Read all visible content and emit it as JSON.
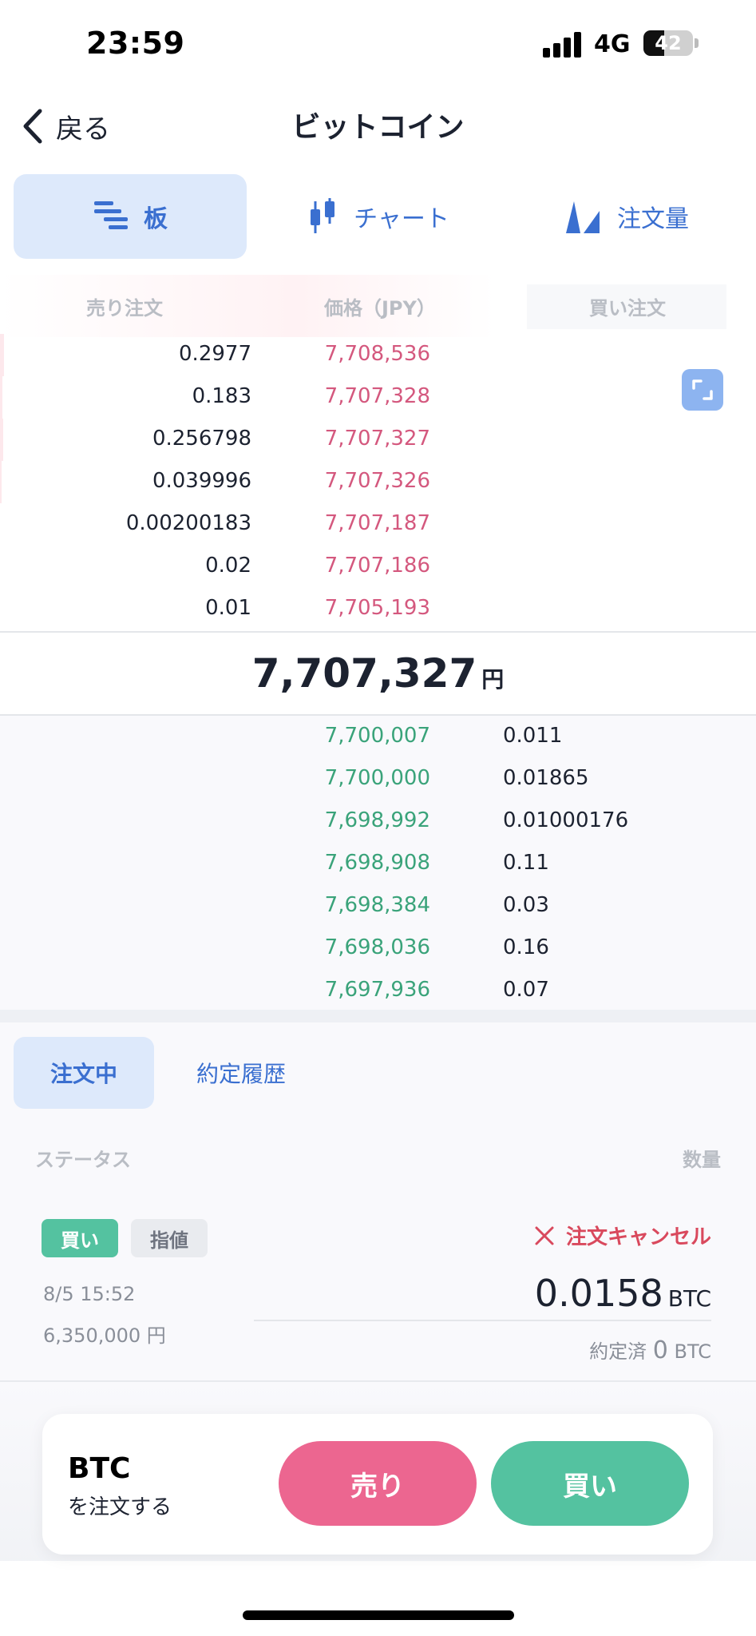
{
  "status_bar": {
    "time": "23:59",
    "network": "4G",
    "battery": "42",
    "battery_level": 0.42
  },
  "nav": {
    "back_label": "戻る",
    "title": "ビットコイン"
  },
  "view_tabs": [
    {
      "label": "板",
      "icon": "order-book-icon",
      "active": true
    },
    {
      "label": "チャート",
      "icon": "candlestick-icon",
      "active": false
    },
    {
      "label": "注文量",
      "icon": "volume-icon",
      "active": false
    }
  ],
  "order_book": {
    "headers": {
      "sell": "売り注文",
      "price": "価格（JPY）",
      "buy": "買い注文"
    },
    "asks": [
      {
        "qty": "0.2977",
        "price": "7,708,536"
      },
      {
        "qty": "0.183",
        "price": "7,707,328"
      },
      {
        "qty": "0.256798",
        "price": "7,707,327"
      },
      {
        "qty": "0.039996",
        "price": "7,707,326"
      },
      {
        "qty": "0.00200183",
        "price": "7,707,187"
      },
      {
        "qty": "0.02",
        "price": "7,707,186"
      },
      {
        "qty": "0.01",
        "price": "7,705,193"
      }
    ],
    "mid": {
      "price": "7,707,327",
      "unit": "円"
    },
    "bids": [
      {
        "price": "7,700,007",
        "qty": "0.011"
      },
      {
        "price": "7,700,000",
        "qty": "0.01865"
      },
      {
        "price": "7,698,992",
        "qty": "0.01000176"
      },
      {
        "price": "7,698,908",
        "qty": "0.11"
      },
      {
        "price": "7,698,384",
        "qty": "0.03"
      },
      {
        "price": "7,698,036",
        "qty": "0.16"
      },
      {
        "price": "7,697,936",
        "qty": "0.07"
      }
    ]
  },
  "orders": {
    "tabs": [
      {
        "label": "注文中",
        "active": true
      },
      {
        "label": "約定履歴",
        "active": false
      }
    ],
    "col_status": "ステータス",
    "col_qty": "数量",
    "item": {
      "side": "買い",
      "type": "指値",
      "cancel": "注文キャンセル",
      "date": "8/5 15:52",
      "price": "6,350,000 円",
      "qty": "0.0158",
      "qty_unit": "BTC",
      "filled_label": "約定済",
      "filled_value": "0",
      "filled_unit": "BTC"
    }
  },
  "order_panel": {
    "symbol": "BTC",
    "subtitle": "を注文する",
    "sell": "売り",
    "buy": "買い"
  },
  "colors": {
    "accent": "#3a6fd0",
    "ask": "#d4587e",
    "bid": "#3aa37a",
    "sell_button": "#ec6690",
    "buy_button": "#54c2a0"
  }
}
